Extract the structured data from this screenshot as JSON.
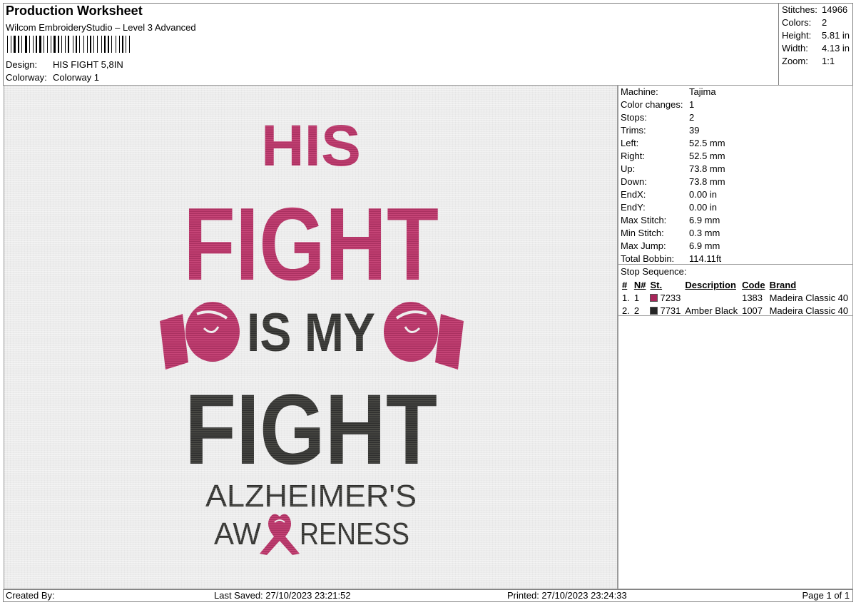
{
  "header": {
    "title": "Production Worksheet",
    "software": "Wilcom EmbroideryStudio – Level 3 Advanced",
    "design_label": "Design:",
    "design_value": "HIS FIGHT 5,8IN",
    "colorway_label": "Colorway:",
    "colorway_value": "Colorway 1"
  },
  "summary": {
    "stitches_label": "Stitches:",
    "stitches_value": "14966",
    "colors_label": "Colors:",
    "colors_value": "2",
    "height_label": "Height:",
    "height_value": "5.81 in",
    "width_label": "Width:",
    "width_value": "4.13 in",
    "zoom_label": "Zoom:",
    "zoom_value": "1:1"
  },
  "design": {
    "line1": "HIS",
    "line2": "FIGHT",
    "line3": "IS MY",
    "line4": "FIGHT",
    "line5": "ALZHEIMER'S",
    "line6_a": "AW",
    "line6_b": "RENESS",
    "pink": "#b8386a",
    "dark": "#3b3b39"
  },
  "properties": [
    {
      "label": "Machine:",
      "value": "Tajima"
    },
    {
      "label": "Color changes:",
      "value": "1"
    },
    {
      "label": "Stops:",
      "value": "2"
    },
    {
      "label": "Trims:",
      "value": "39"
    },
    {
      "label": "Left:",
      "value": "52.5 mm"
    },
    {
      "label": "Right:",
      "value": "52.5 mm"
    },
    {
      "label": "Up:",
      "value": "73.8 mm"
    },
    {
      "label": "Down:",
      "value": "73.8 mm"
    },
    {
      "label": "EndX:",
      "value": "0.00 in"
    },
    {
      "label": "EndY:",
      "value": "0.00 in"
    },
    {
      "label": "Max Stitch:",
      "value": "6.9 mm"
    },
    {
      "label": "Min Stitch:",
      "value": "0.3 mm"
    },
    {
      "label": "Max Jump:",
      "value": "6.9 mm"
    },
    {
      "label": "Total Bobbin:",
      "value": "114.11ft"
    }
  ],
  "stop_sequence": {
    "title": "Stop Sequence:",
    "headers": {
      "num": "#",
      "n": "N#",
      "st": "St.",
      "description": "Description",
      "code": "Code",
      "brand": "Brand"
    },
    "rows": [
      {
        "num": "1.",
        "n": "1",
        "color": "#a8265a",
        "st": "7233",
        "description": "",
        "code": "1383",
        "brand": "Madeira Classic 40"
      },
      {
        "num": "2.",
        "n": "2",
        "color": "#262626",
        "st": "7731",
        "description": "Amber Black",
        "code": "1007",
        "brand": "Madeira Classic 40"
      }
    ]
  },
  "footer": {
    "created_by": "Created By:",
    "last_saved": "Last Saved: 27/10/2023 23:21:52",
    "printed": "Printed: 27/10/2023 23:24:33",
    "page": "Page 1 of 1"
  }
}
